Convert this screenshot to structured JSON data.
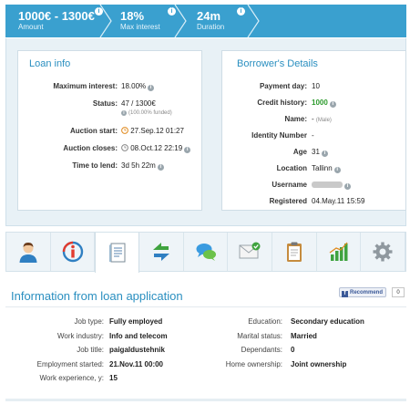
{
  "ribbon": {
    "amount": {
      "value": "1000€ - 1300€",
      "label": "Amount"
    },
    "interest": {
      "value": "18%",
      "label": "Max interest"
    },
    "duration": {
      "value": "24m",
      "label": "Duration"
    },
    "info_glyph": "i"
  },
  "loan_info": {
    "title": "Loan info",
    "max_interest_label": "Maximum interest:",
    "max_interest_value": "18.00%",
    "status_label": "Status:",
    "status_value": "47 / 1300€",
    "status_funded": "(100.00% funded)",
    "auction_start_label": "Auction start:",
    "auction_start_value": "27.Sep.12 01:27",
    "auction_closes_label": "Auction closes:",
    "auction_closes_value": "08.Oct.12 22:19",
    "time_to_lend_label": "Time to lend:",
    "time_to_lend_value": "3d 5h 22m"
  },
  "borrower": {
    "title": "Borrower's Details",
    "payment_day_label": "Payment day:",
    "payment_day_value": "10",
    "credit_history_label": "Credit history:",
    "credit_history_value": "1000",
    "name_label": "Name:",
    "name_value": "-",
    "name_gender": "(Male)",
    "identity_label": "Identity Number",
    "identity_value": "-",
    "age_label": "Age",
    "age_value": "31",
    "location_label": "Location",
    "location_value": "Tallinn",
    "username_label": "Username",
    "registered_label": "Registered",
    "registered_value": "04.May.11 15:59"
  },
  "tabs": [
    {
      "icon": "person-icon"
    },
    {
      "icon": "info-icon"
    },
    {
      "icon": "document-icon",
      "active": true
    },
    {
      "icon": "transfer-arrows-icon"
    },
    {
      "icon": "chat-bubbles-icon"
    },
    {
      "icon": "envelope-check-icon"
    },
    {
      "icon": "clipboard-icon"
    },
    {
      "icon": "bar-chart-icon"
    },
    {
      "icon": "gear-icon"
    }
  ],
  "application": {
    "title": "Information from loan application",
    "recommend_label": "Recommend",
    "recommend_count": "0",
    "left": [
      {
        "label": "Job type:",
        "value": "Fully employed"
      },
      {
        "label": "Work industry:",
        "value": "Info and telecom"
      },
      {
        "label": "Job title:",
        "value": "paigaldustehnik"
      },
      {
        "label": "Employment started:",
        "value": "21.Nov.11 00:00"
      },
      {
        "label": "Work experience, y:",
        "value": "15"
      }
    ],
    "right": [
      {
        "label": "Education:",
        "value": "Secondary education"
      },
      {
        "label": "Marital status:",
        "value": "Married"
      },
      {
        "label": "Dependants:",
        "value": "0"
      },
      {
        "label": "Home ownership:",
        "value": "Joint ownership"
      }
    ]
  },
  "colors": {
    "accent": "#3aa0cf",
    "title_blue": "#2a8fc0",
    "credit_green": "#2b9a2b"
  }
}
